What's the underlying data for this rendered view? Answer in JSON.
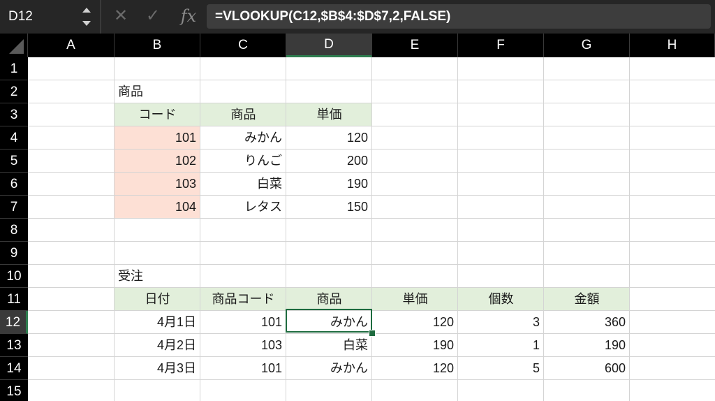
{
  "formula_bar": {
    "name_box": "D12",
    "cancel_icon": "✕",
    "enter_icon": "✓",
    "fx_label": "fx",
    "formula": "=VLOOKUP(C12,$B$4:$D$7,2,FALSE)"
  },
  "columns": [
    "A",
    "B",
    "C",
    "D",
    "E",
    "F",
    "G",
    "H"
  ],
  "rows": [
    "1",
    "2",
    "3",
    "4",
    "5",
    "6",
    "7",
    "8",
    "9",
    "10",
    "11",
    "12",
    "13",
    "14",
    "15"
  ],
  "selected_cell": "D12",
  "colors": {
    "header_fill": "#e2efdb",
    "code_fill": "#fde0d5",
    "selection": "#1e6b3f"
  },
  "product_table": {
    "title": "商品",
    "headers": [
      "コード",
      "商品",
      "単価"
    ],
    "rows": [
      [
        "101",
        "みかん",
        "120"
      ],
      [
        "102",
        "りんご",
        "200"
      ],
      [
        "103",
        "白菜",
        "190"
      ],
      [
        "104",
        "レタス",
        "150"
      ]
    ]
  },
  "order_table": {
    "title": "受注",
    "headers": [
      "日付",
      "商品コード",
      "商品",
      "単価",
      "個数",
      "金額"
    ],
    "rows": [
      [
        "4月1日",
        "101",
        "みかん",
        "120",
        "3",
        "360"
      ],
      [
        "4月2日",
        "103",
        "白菜",
        "190",
        "1",
        "190"
      ],
      [
        "4月3日",
        "101",
        "みかん",
        "120",
        "5",
        "600"
      ]
    ]
  }
}
